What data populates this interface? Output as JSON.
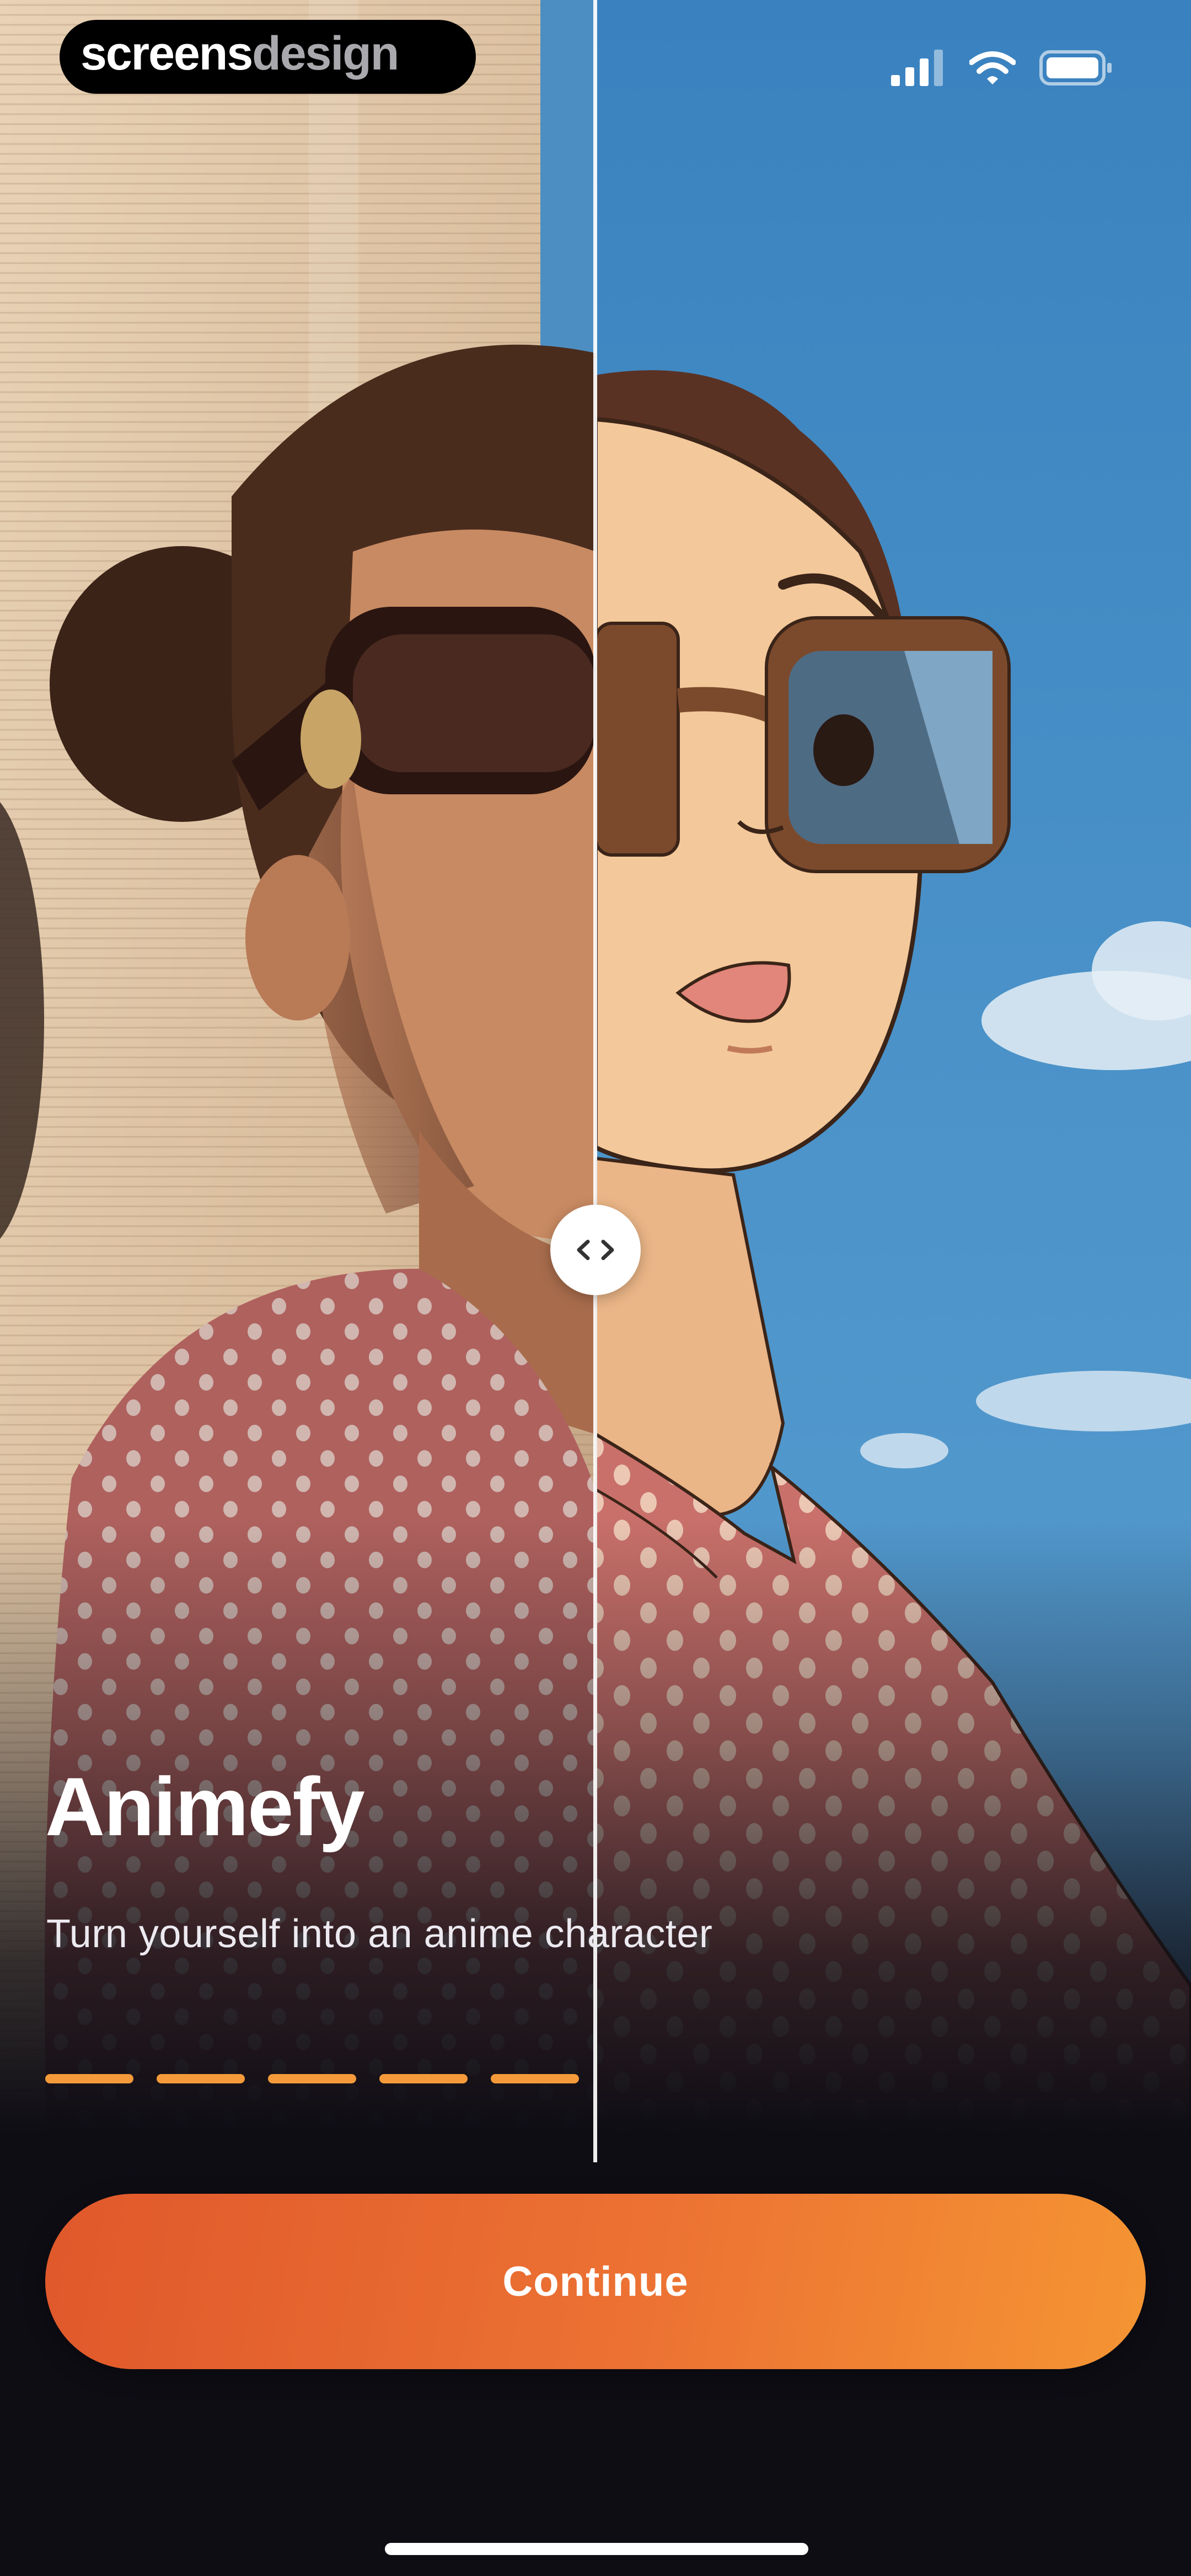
{
  "status_bar": {
    "watermark": {
      "text_primary": "screens",
      "text_secondary": "design"
    },
    "icons": [
      "cellular-signal-icon",
      "wifi-icon",
      "battery-icon"
    ]
  },
  "hero": {
    "left_style": "photo",
    "right_style": "anime",
    "handle_icon": "compare-arrows-icon"
  },
  "onboarding": {
    "title": "Animefy",
    "subtitle": "Turn yourself into an anime character",
    "pages_total": 5
  },
  "actions": {
    "continue_label": "Continue"
  },
  "colors": {
    "background": "#0e0d14",
    "accent": "#f49a3a",
    "button_gradient_start": "#e0582b",
    "button_gradient_end": "#f59533",
    "text_primary": "#ffffff"
  }
}
